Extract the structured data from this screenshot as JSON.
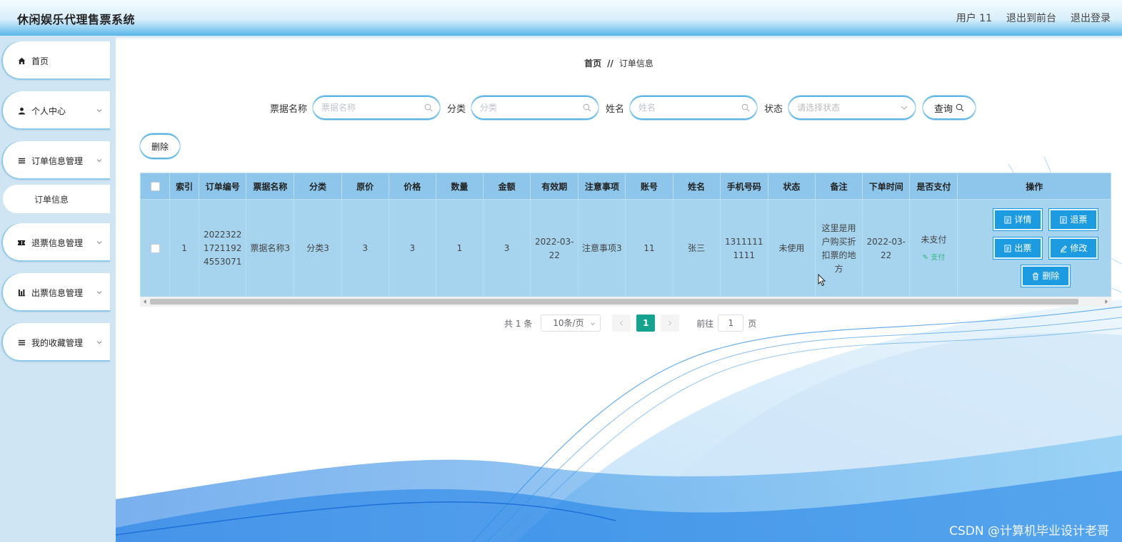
{
  "header": {
    "app_title": "休闲娱乐代理售票系统",
    "user_label": "用户 11",
    "back_to_front": "退出到前台",
    "logout": "退出登录"
  },
  "sidebar": {
    "items": [
      {
        "label": "首页",
        "icon": "home-icon"
      },
      {
        "label": "个人中心",
        "icon": "user-icon"
      },
      {
        "label": "订单信息管理",
        "icon": "list-icon"
      },
      {
        "label": "退票信息管理",
        "icon": "ticket-icon"
      },
      {
        "label": "出票信息管理",
        "icon": "chart-icon"
      },
      {
        "label": "我的收藏管理",
        "icon": "menu-icon"
      }
    ],
    "sub_item": "订单信息"
  },
  "breadcrumb": {
    "home": "首页",
    "sep": "//",
    "current": "订单信息"
  },
  "search": {
    "ticket_name_label": "票据名称",
    "ticket_name_placeholder": "票据名称",
    "category_label": "分类",
    "category_placeholder": "分类",
    "name_label": "姓名",
    "name_placeholder": "姓名",
    "status_label": "状态",
    "status_placeholder": "请选择状态",
    "query_label": "查询"
  },
  "toolbar": {
    "delete_label": "删除"
  },
  "table": {
    "columns": [
      "索引",
      "订单编号",
      "票据名称",
      "分类",
      "原价",
      "价格",
      "数量",
      "金额",
      "有效期",
      "注意事项",
      "账号",
      "姓名",
      "手机号码",
      "状态",
      "备注",
      "下单时间",
      "是否支付",
      "操作"
    ],
    "rows": [
      {
        "index": "1",
        "order_no": "20223221721192 4553071",
        "ticket_name": "票据名称3",
        "category": "分类3",
        "original_price": "3",
        "price": "3",
        "quantity": "1",
        "amount": "3",
        "valid_date": "2022-03-22",
        "notice": "注意事项3",
        "account": "11",
        "name": "张三",
        "phone": "13111111111",
        "status": "未使用",
        "remark": "这里是用户购买折扣票的地方",
        "order_time": "2022-03-22",
        "pay_state": "未支付",
        "pay_link": "支付"
      }
    ],
    "actions": {
      "detail": "详情",
      "refund": "退票",
      "issue": "出票",
      "edit": "修改",
      "delete": "删除"
    }
  },
  "pagination": {
    "total_text": "共 1 条",
    "page_size": "10条/页",
    "current_page": "1",
    "goto_label": "前往",
    "goto_value": "1",
    "page_unit": "页"
  },
  "watermark": "CSDN @计算机毕业设计老哥",
  "colors": {
    "header_gradient_end": "#58b7ea",
    "sidebar_bg": "#cfe5f3",
    "table_header": "#8dc6ea",
    "table_row": "#a6d4ef",
    "action_button": "#1d9be0",
    "page_active": "#15a28f"
  }
}
